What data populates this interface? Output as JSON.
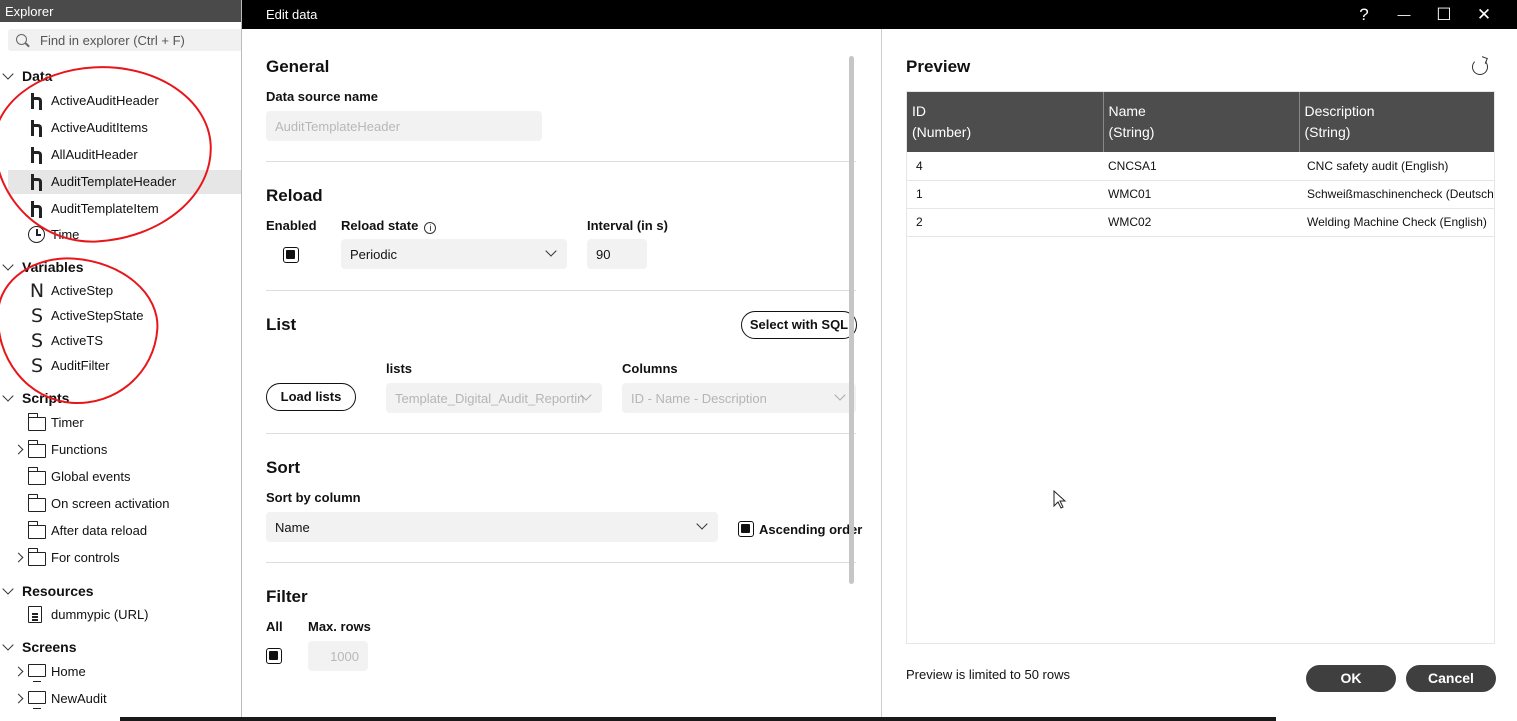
{
  "explorer": {
    "title": "Explorer",
    "search_placeholder": "Find in explorer (Ctrl + F)",
    "sections": {
      "data": "Data",
      "variables": "Variables",
      "scripts": "Scripts",
      "resources": "Resources",
      "screens": "Screens"
    },
    "data_items": [
      "ActiveAuditHeader",
      "ActiveAuditItems",
      "AllAuditHeader",
      "AuditTemplateHeader",
      "AuditTemplateItem",
      "Time"
    ],
    "variable_items": [
      "ActiveStep",
      "ActiveStepState",
      "ActiveTS",
      "AuditFilter"
    ],
    "variable_icons": [
      "N",
      "S",
      "S",
      "S"
    ],
    "script_items": [
      "Timer",
      "Functions",
      "Global events",
      "On screen activation",
      "After data reload",
      "For controls"
    ],
    "resource_items": [
      "dummypic (URL)"
    ],
    "screen_items": [
      "Home",
      "NewAudit"
    ]
  },
  "dialog": {
    "title": "Edit data",
    "titlebar_buttons": {
      "help": "?",
      "minimize": "—",
      "maximize": "☐",
      "close": "✕"
    },
    "general": {
      "heading": "General",
      "data_source_name_label": "Data source name",
      "data_source_name_value": "AuditTemplateHeader"
    },
    "reload": {
      "heading": "Reload",
      "enabled_label": "Enabled",
      "reload_state_label": "Reload state",
      "reload_state_value": "Periodic",
      "interval_label": "Interval (in s)",
      "interval_value": "90"
    },
    "list": {
      "heading": "List",
      "select_sql_button": "Select with SQL",
      "load_lists_button": "Load lists",
      "lists_label": "lists",
      "lists_value": "Template_Digital_Audit_Reporting",
      "columns_label": "Columns",
      "columns_value": "ID - Name - Description"
    },
    "sort": {
      "heading": "Sort",
      "sort_by_label": "Sort by column",
      "sort_by_value": "Name",
      "ascending_label": "Ascending order"
    },
    "filter": {
      "heading": "Filter",
      "all_label": "All",
      "max_rows_label": "Max. rows",
      "max_rows_value": "1000"
    },
    "preview": {
      "heading": "Preview",
      "columns": [
        {
          "name": "ID",
          "type": "(Number)"
        },
        {
          "name": "Name",
          "type": "(String)"
        },
        {
          "name": "Description",
          "type": "(String)"
        }
      ],
      "rows": [
        [
          "4",
          "CNCSA1",
          "CNC safety audit (English)"
        ],
        [
          "1",
          "WMC01",
          "Schweißmaschinencheck (Deutsch)"
        ],
        [
          "2",
          "WMC02",
          "Welding Machine Check (English)"
        ]
      ],
      "note": "Preview is limited to 50 rows"
    },
    "ok_button": "OK",
    "cancel_button": "Cancel"
  }
}
